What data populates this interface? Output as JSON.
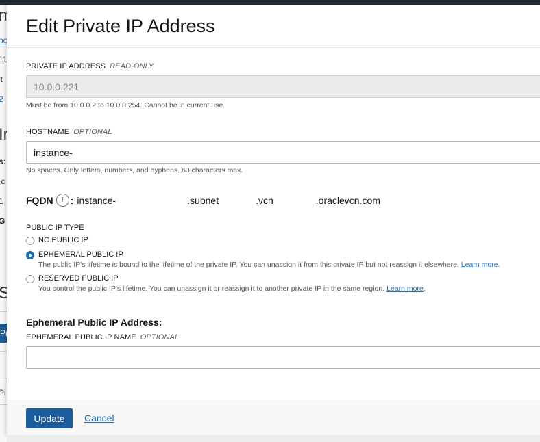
{
  "background_page": {
    "fragments": [
      "m",
      "nc",
      "11",
      "it",
      "2",
      "Ir",
      "s:",
      ".c",
      "1",
      "G",
      "S",
      "Pr",
      "Pi"
    ]
  },
  "dialog": {
    "title": "Edit Private IP Address",
    "private_ip": {
      "label": "PRIVATE IP ADDRESS",
      "qualifier": "READ-ONLY",
      "value": "10.0.0.221",
      "help": "Must be from 10.0.0.2 to 10.0.0.254. Cannot be in current use."
    },
    "hostname": {
      "label": "HOSTNAME",
      "qualifier": "OPTIONAL",
      "value": "instance-",
      "help": "No spaces. Only letters, numbers, and hyphens. 63 characters max."
    },
    "fqdn": {
      "label": "FQDN",
      "info_icon": "i",
      "separator": ":",
      "part1": "instance-",
      "part2": ".subnet",
      "part3": ".vcn",
      "part4": ".oraclevcn.com"
    },
    "public_ip_type": {
      "label": "PUBLIC IP TYPE",
      "options": [
        {
          "label": "NO PUBLIC IP",
          "checked": false,
          "desc": "",
          "link": ""
        },
        {
          "label": "EPHEMERAL PUBLIC IP",
          "checked": true,
          "desc": "The public IP's lifetime is bound to the lifetime of the private IP. You can unassign it from this private IP but not reassign it elsewhere.",
          "link": "Learn more"
        },
        {
          "label": "RESERVED PUBLIC IP",
          "checked": false,
          "desc": "You control the public IP's lifetime. You can unassign it or reassign it to another private IP in the same region.",
          "link": "Learn more"
        }
      ]
    },
    "ephemeral_section": {
      "heading": "Ephemeral Public IP Address:",
      "name_label": "EPHEMERAL PUBLIC IP NAME",
      "name_qualifier": "OPTIONAL",
      "name_value": ""
    },
    "footer": {
      "update_label": "Update",
      "cancel_label": "Cancel"
    }
  },
  "colors": {
    "primary": "#1d5c9c",
    "link": "#1d6ab5",
    "topbar": "#1f2a36"
  }
}
